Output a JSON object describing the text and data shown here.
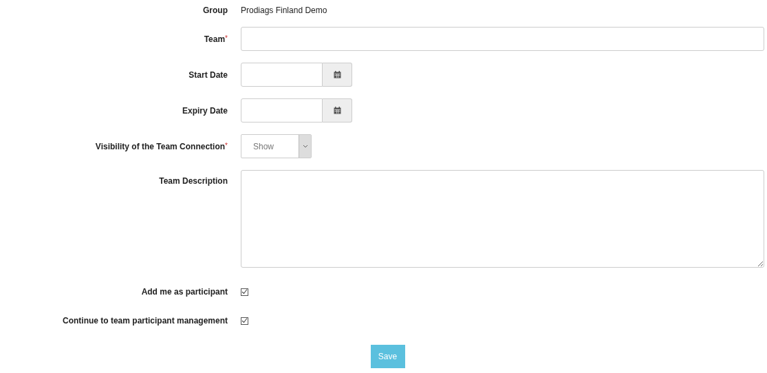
{
  "fields": [
    {
      "kind": "static",
      "label": "Group",
      "value": "Prodiags Finland Demo"
    },
    {
      "kind": "text",
      "label": "Team",
      "required_mark": "*"
    },
    {
      "kind": "date",
      "label": "Start Date"
    },
    {
      "kind": "date",
      "label": "Expiry Date"
    },
    {
      "kind": "select",
      "label": "Visibility of the Team Connection",
      "required_mark": "*",
      "value": "Show"
    },
    {
      "kind": "textarea",
      "label": "Team Description"
    },
    {
      "kind": "checkbox",
      "label": "Add me as participant",
      "checked": true
    },
    {
      "kind": "checkbox",
      "label": "Continue to team participant management",
      "checked": true
    }
  ],
  "save_button": "Save"
}
